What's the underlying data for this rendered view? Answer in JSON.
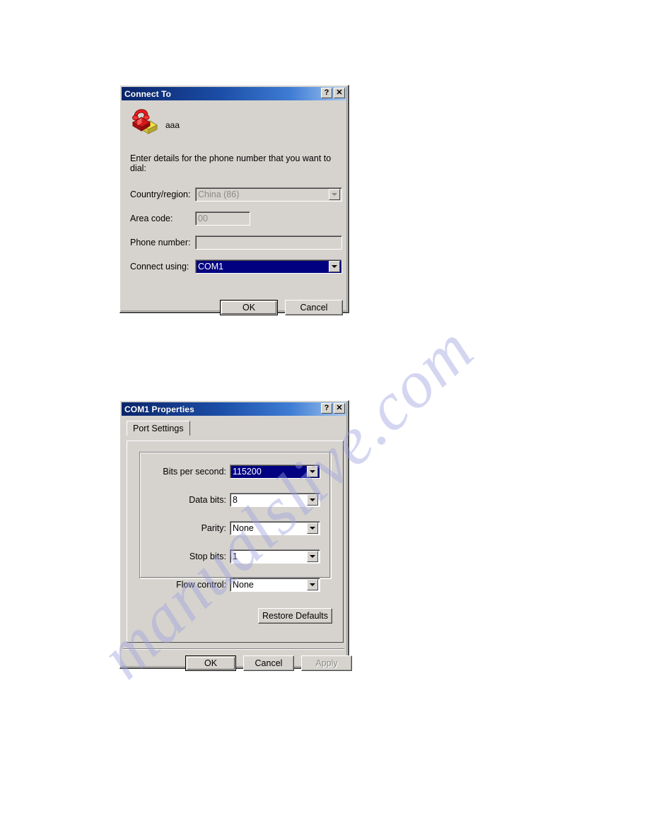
{
  "page": {
    "background": "#ffffff",
    "watermark": "manualslive.com",
    "watermark_color": "#9b9fe0"
  },
  "dialog_connect_to": {
    "title": "Connect To",
    "titlebar_buttons": [
      {
        "name": "help-button",
        "glyph": "?"
      },
      {
        "name": "close-button",
        "glyph": "✕"
      }
    ],
    "connection_icon": "phone-modem-icon",
    "connection_name": "aaa",
    "intro_text": "Enter details for the phone number that you want to dial:",
    "fields": [
      {
        "label": "Country/region:",
        "value": "China (86)",
        "type": "combobox",
        "disabled": true,
        "selected": false
      },
      {
        "label": "Area code:",
        "value": "00",
        "type": "textbox",
        "disabled": true,
        "selected": false
      },
      {
        "label": "Phone number:",
        "value": "",
        "type": "textbox",
        "disabled": true,
        "selected": false
      },
      {
        "label": "Connect using:",
        "value": "COM1",
        "type": "combobox",
        "disabled": false,
        "selected": true
      }
    ],
    "buttons": [
      {
        "label": "OK",
        "default": true,
        "disabled": false
      },
      {
        "label": "Cancel",
        "default": false,
        "disabled": false
      }
    ]
  },
  "dialog_com1_properties": {
    "title": "COM1 Properties",
    "titlebar_buttons": [
      {
        "name": "help-button",
        "glyph": "?"
      },
      {
        "name": "close-button",
        "glyph": "✕"
      }
    ],
    "tabs": [
      {
        "label": "Port Settings",
        "active": true
      }
    ],
    "settings": [
      {
        "label": "Bits per second:",
        "value": "115200",
        "selected": true
      },
      {
        "label": "Data bits:",
        "value": "8",
        "selected": false
      },
      {
        "label": "Parity:",
        "value": "None",
        "selected": false
      },
      {
        "label": "Stop bits:",
        "value": "1",
        "selected": false
      },
      {
        "label": "Flow control:",
        "value": "None",
        "selected": false
      }
    ],
    "restore_defaults_label": "Restore Defaults",
    "buttons": [
      {
        "label": "OK",
        "default": true,
        "disabled": false
      },
      {
        "label": "Cancel",
        "default": false,
        "disabled": false
      },
      {
        "label": "Apply",
        "default": false,
        "disabled": true
      }
    ]
  },
  "colors": {
    "dialog_face": "#d6d3ce",
    "titlebar_start": "#0a246a",
    "titlebar_end": "#a6c8f0",
    "selection_blue": "#000080",
    "disabled_text": "#8a8a84"
  }
}
